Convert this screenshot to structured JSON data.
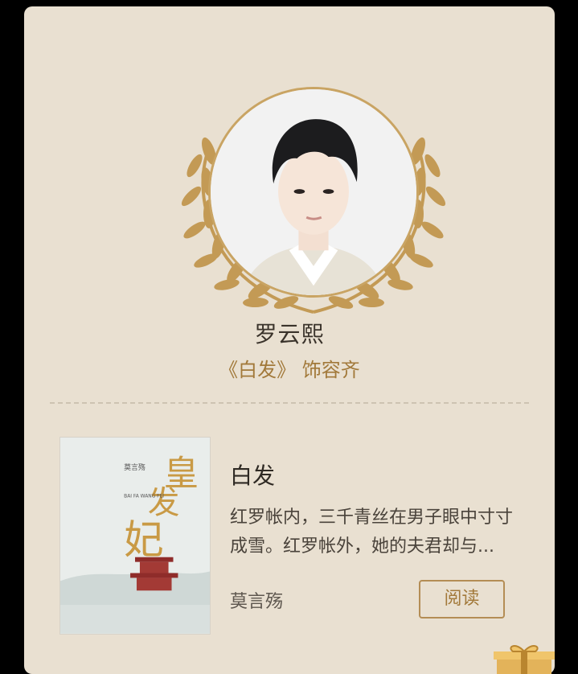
{
  "actor": {
    "name": "罗云熙",
    "role": "《白发》 饰容齐"
  },
  "book": {
    "title": "白发",
    "description": "红罗帐内，三千青丝在男子眼中寸寸成雪。红罗帐外，她的夫君却与...",
    "author": "莫言殇",
    "read_label": "阅读",
    "cover": {
      "title_chars": "皇发妃",
      "author": "莫言殇",
      "pinyin": "BAI FA WANG FEI"
    }
  },
  "icons": {
    "laurel": "laurel-wreath-icon",
    "gift": "gift-box-icon"
  },
  "colors": {
    "card_background": "#e9e0d1",
    "accent_gold": "#a2793a",
    "frame_gold": "#c9a463"
  }
}
